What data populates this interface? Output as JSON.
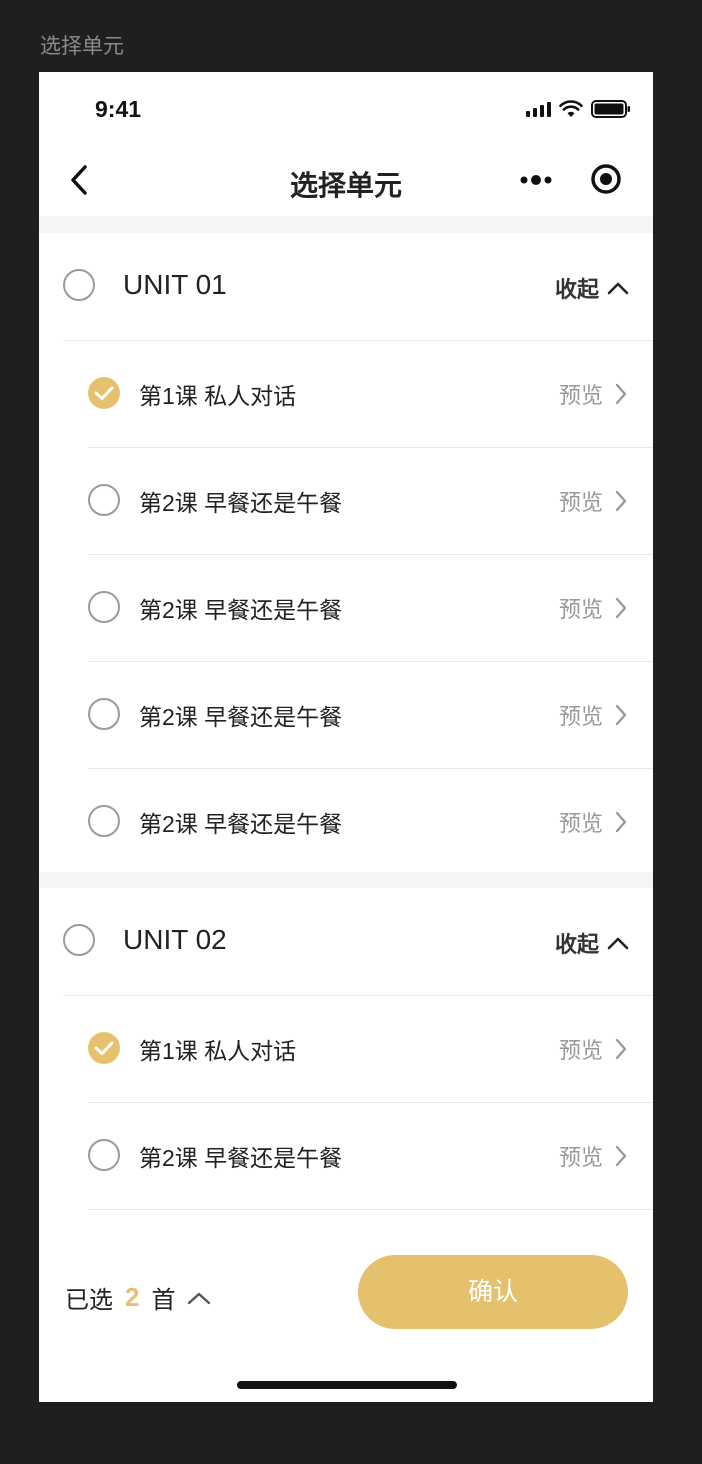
{
  "frame_label": "选择单元",
  "status_bar": {
    "time": "9:41"
  },
  "nav": {
    "title": "选择单元",
    "back_icon": "chevron-left-icon",
    "more_icon": "more-dots-icon",
    "target_icon": "record-icon"
  },
  "units": [
    {
      "title": "UNIT 01",
      "collapse_label": "收起",
      "selected": false,
      "lessons": [
        {
          "label": "第1课 私人对话",
          "checked": true,
          "preview_label": "预览"
        },
        {
          "label": "第2课 早餐还是午餐",
          "checked": false,
          "preview_label": "预览"
        },
        {
          "label": "第2课 早餐还是午餐",
          "checked": false,
          "preview_label": "预览"
        },
        {
          "label": "第2课 早餐还是午餐",
          "checked": false,
          "preview_label": "预览"
        },
        {
          "label": "第2课 早餐还是午餐",
          "checked": false,
          "preview_label": "预览"
        }
      ]
    },
    {
      "title": "UNIT 02",
      "collapse_label": "收起",
      "selected": false,
      "lessons": [
        {
          "label": "第1课 私人对话",
          "checked": true,
          "preview_label": "预览"
        },
        {
          "label": "第2课 早餐还是午餐",
          "checked": false,
          "preview_label": "预览"
        }
      ]
    }
  ],
  "footer": {
    "selected_prefix": "已选",
    "selected_count": "2",
    "selected_suffix": "首",
    "confirm_label": "确认"
  },
  "colors": {
    "accent": "#e5c16e",
    "text": "#222222",
    "muted": "#999999",
    "divider": "#e9e9e9"
  }
}
